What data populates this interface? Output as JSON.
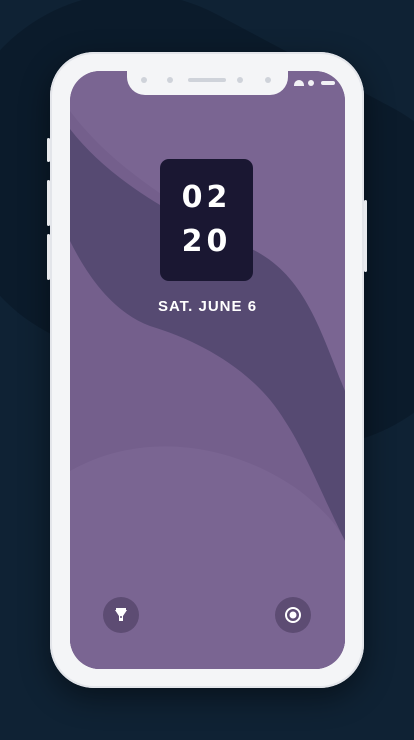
{
  "lockscreen": {
    "hours": "02",
    "minutes": "20",
    "date": "SAT. JUNE 6"
  },
  "shortcuts": {
    "left_icon": "flashlight-icon",
    "right_icon": "camera-icon"
  },
  "colors": {
    "background": "#0f2234",
    "wallpaper": "#7a6592",
    "wave": "#564a72",
    "clock_card": "#1a1732",
    "shortcut_button": "#5d4c73",
    "phone_frame": "#f4f5f7"
  }
}
